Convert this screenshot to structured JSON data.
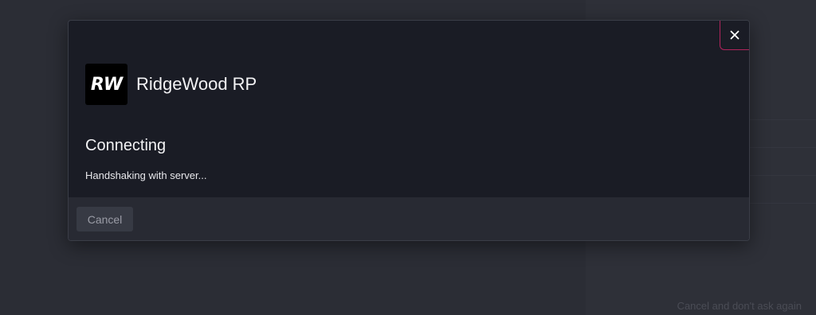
{
  "modal": {
    "server_logo_text": "RW",
    "server_name": "RidgeWood RP",
    "status_title": "Connecting",
    "status_detail": "Handshaking with server...",
    "cancel_label": "Cancel",
    "close_icon": "close-icon"
  },
  "background": {
    "footer_link": "Cancel and don't ask again"
  },
  "colors": {
    "modal_bg": "#1a1c25",
    "footer_bg": "#282a33",
    "close_accent": "#b0245c",
    "text_primary": "#f2f2f4"
  }
}
